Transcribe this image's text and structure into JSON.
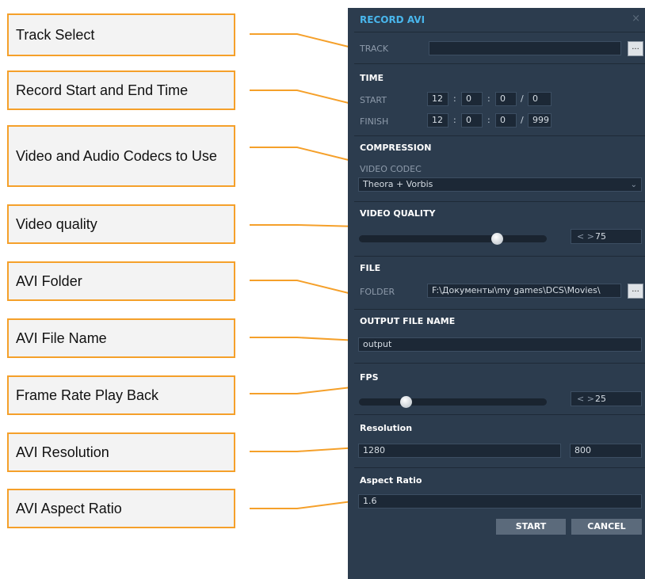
{
  "callouts": {
    "track_select": "Track Select",
    "record_time": "Record Start and End Time",
    "codecs": "Video and Audio Codecs to Use",
    "video_quality": "Video quality",
    "avi_folder": "AVI Folder",
    "avi_file_name": "AVI File Name",
    "frame_rate": "Frame Rate Play Back",
    "avi_resolution": "AVI Resolution",
    "avi_aspect_ratio": "AVI Aspect Ratio"
  },
  "dialog": {
    "title": "RECORD AVI",
    "close_icon": "×",
    "track": {
      "label": "TRACK",
      "value": "",
      "browse": "..."
    },
    "time": {
      "header": "TIME",
      "start": {
        "label": "START",
        "h": "12",
        "m": "0",
        "s": "0",
        "f": "0"
      },
      "finish": {
        "label": "FINISH",
        "h": "12",
        "m": "0",
        "s": "0",
        "f": "999"
      },
      "sep_colon": ":",
      "sep_slash": "/"
    },
    "compression": {
      "header": "COMPRESSION",
      "label": "VIDEO CODEC",
      "value": "Theora + Vorbis",
      "chevron": "⌄"
    },
    "video_quality": {
      "header": "VIDEO QUALITY",
      "value": "75",
      "level": 0.75,
      "arrows": "< >"
    },
    "file": {
      "header": "FILE",
      "label": "FOLDER",
      "value": "F:\\Документы\\my games\\DCS\\Movies\\",
      "browse": "..."
    },
    "output_file_name": {
      "header": "OUTPUT FILE NAME",
      "value": "output"
    },
    "fps": {
      "header": "FPS",
      "value": "25",
      "arrows": "< >"
    },
    "resolution": {
      "header": "Resolution",
      "width": "1280",
      "height": "800"
    },
    "aspect_ratio": {
      "header": "Aspect Ratio",
      "value": "1.6"
    },
    "buttons": {
      "start": "START",
      "cancel": "CANCEL"
    }
  },
  "colors": {
    "callout_border": "#f5a02a",
    "panel_bg": "#2c3c4e",
    "title": "#49b6ec"
  }
}
